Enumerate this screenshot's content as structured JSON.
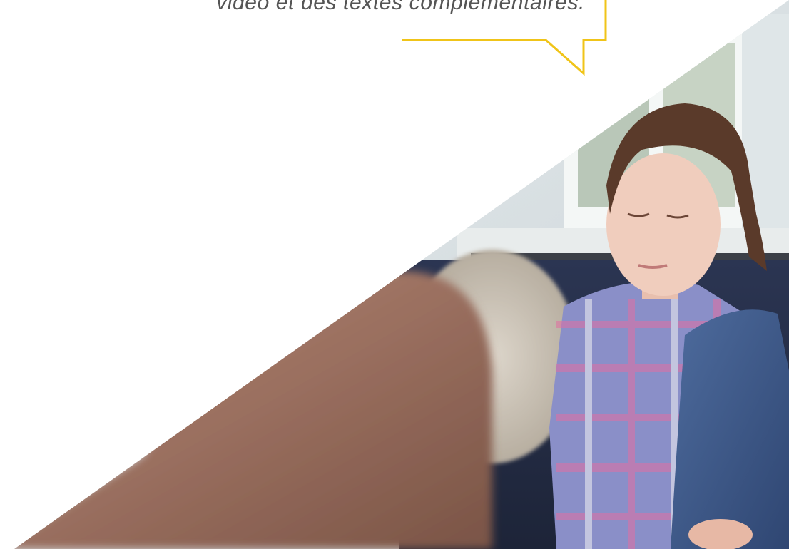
{
  "quote": {
    "text": "vidéo et des textes complémentaires."
  },
  "colors": {
    "bubble_outline": "#f0c419",
    "text": "#555555",
    "background": "#ffffff"
  },
  "hero": {
    "subject": "girl in plaid shirt seated on sofa listening, adult blurred in foreground",
    "icon": "photo"
  }
}
